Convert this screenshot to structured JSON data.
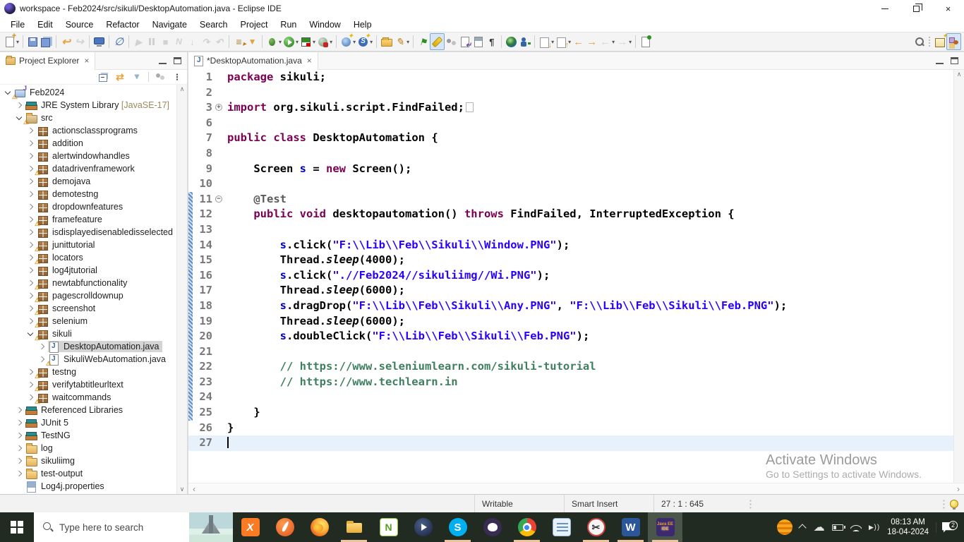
{
  "window": {
    "title": "workspace - Feb2024/src/sikuli/DesktopAutomation.java - Eclipse IDE",
    "controls": {
      "minimize": "minimize",
      "restore": "restore",
      "close": "×"
    }
  },
  "menu": {
    "items": [
      "File",
      "Edit",
      "Source",
      "Refactor",
      "Navigate",
      "Search",
      "Project",
      "Run",
      "Window",
      "Help"
    ]
  },
  "toolbar": {
    "items": [
      {
        "name": "new-wizard",
        "kind": "doc-new",
        "dd": true
      },
      {
        "sep": true
      },
      {
        "name": "save",
        "kind": "floppy"
      },
      {
        "name": "save-all",
        "kind": "floppy-all"
      },
      {
        "sep": true
      },
      {
        "name": "undo",
        "kind": "arr-undo"
      },
      {
        "name": "redo",
        "kind": "arr-redo",
        "dis": true
      },
      {
        "sep": true
      },
      {
        "name": "open-console",
        "kind": "monitor"
      },
      {
        "sep": true
      },
      {
        "name": "skip-all-breakpoints",
        "kind": "skipbp"
      },
      {
        "sep": true
      },
      {
        "name": "resume",
        "kind": "gplay",
        "dis": true
      },
      {
        "name": "suspend",
        "kind": "gpause",
        "dis": true
      },
      {
        "name": "terminate",
        "kind": "gstop",
        "dis": true
      },
      {
        "name": "disconnect",
        "kind": "gdisc",
        "dis": true
      },
      {
        "name": "step-into",
        "kind": "gstep1",
        "dis": true
      },
      {
        "name": "step-over",
        "kind": "gstep2",
        "dis": true
      },
      {
        "name": "step-return",
        "kind": "gstep3",
        "dis": true
      },
      {
        "sep": true
      },
      {
        "name": "run-last-tool",
        "kind": "linesrun"
      },
      {
        "name": "run-tool-config",
        "kind": "funnelrun"
      },
      {
        "sep": true
      },
      {
        "name": "debug",
        "kind": "bug",
        "dd": true
      },
      {
        "name": "run",
        "kind": "run",
        "dd": true
      },
      {
        "name": "coverage",
        "kind": "coverage",
        "dd": true
      },
      {
        "name": "profile",
        "kind": "profile",
        "dd": true
      },
      {
        "sep": true
      },
      {
        "name": "new-servlet",
        "kind": "globenew",
        "dd": true
      },
      {
        "name": "new-web-service",
        "kind": "sglobe",
        "dd": true
      },
      {
        "sep": true
      },
      {
        "name": "open-file",
        "kind": "folderopen"
      },
      {
        "name": "open-task",
        "kind": "pen",
        "dd": true
      },
      {
        "sep": true
      },
      {
        "name": "pin-editor",
        "kind": "pin"
      },
      {
        "name": "mark-occurrences",
        "kind": "highlighter",
        "active": true
      },
      {
        "name": "show-selected-element",
        "kind": "graydots"
      },
      {
        "name": "next-edit-location",
        "kind": "docarrow"
      },
      {
        "name": "last-edit-location",
        "kind": "doclines"
      },
      {
        "name": "show-whitespace",
        "kind": "pilcrow"
      },
      {
        "sep": true
      },
      {
        "name": "open-web-browser",
        "kind": "globe"
      },
      {
        "name": "run-external-tools",
        "kind": "personrun"
      },
      {
        "sep": true
      },
      {
        "name": "next-annotation",
        "kind": "boxdown",
        "dd": true
      },
      {
        "name": "previous-annotation",
        "kind": "boxup",
        "dd": true
      },
      {
        "name": "back-edit",
        "kind": "yleft"
      },
      {
        "name": "forward-edit",
        "kind": "yright"
      },
      {
        "name": "back",
        "kind": "gleft",
        "dd": true,
        "dis": true
      },
      {
        "name": "forward",
        "kind": "gright",
        "dd": true,
        "dis": true
      },
      {
        "sep": true
      },
      {
        "name": "new-untitled-file",
        "kind": "docpin"
      }
    ],
    "right": [
      {
        "name": "search",
        "kind": "mag"
      },
      {
        "dots": true
      },
      {
        "name": "open-perspective",
        "kind": "persp"
      },
      {
        "name": "perspective-javaee",
        "kind": "perspee",
        "active": true
      }
    ]
  },
  "explorer": {
    "tab_label": "Project Explorer",
    "close_label": "×",
    "toolbar": [
      {
        "name": "collapse-all",
        "kind": "collapse"
      },
      {
        "name": "link-with-editor",
        "kind": "link"
      },
      {
        "name": "filters",
        "kind": "filter"
      },
      {
        "sep": true
      },
      {
        "name": "focus-on-active-task",
        "kind": "focus"
      },
      {
        "name": "view-menu",
        "kind": "menu"
      }
    ],
    "tree": [
      {
        "label": "Feb2024",
        "depth": 0,
        "icon": "project",
        "arrow": "exp",
        "warn": true
      },
      {
        "label": "JRE System Library",
        "suffix": " [JavaSE-17]",
        "depth": 1,
        "icon": "lib",
        "arrow": "col"
      },
      {
        "label": "src",
        "depth": 1,
        "icon": "srcfolder",
        "arrow": "exp",
        "warn": true
      },
      {
        "label": "actionsclassprograms",
        "depth": 2,
        "icon": "pkg",
        "arrow": "col"
      },
      {
        "label": "addition",
        "depth": 2,
        "icon": "pkg",
        "arrow": "col"
      },
      {
        "label": "alertwindowhandles",
        "depth": 2,
        "icon": "pkg",
        "arrow": "col"
      },
      {
        "label": "datadrivenframework",
        "depth": 2,
        "icon": "pkg",
        "arrow": "col",
        "warn": true
      },
      {
        "label": "demojava",
        "depth": 2,
        "icon": "pkg",
        "arrow": "col"
      },
      {
        "label": "demotestng",
        "depth": 2,
        "icon": "pkg",
        "arrow": "col"
      },
      {
        "label": "dropdownfeatures",
        "depth": 2,
        "icon": "pkg",
        "arrow": "col"
      },
      {
        "label": "framefeature",
        "depth": 2,
        "icon": "pkg",
        "arrow": "col",
        "warn": true
      },
      {
        "label": "isdisplayedisenabledisselected",
        "depth": 2,
        "icon": "pkg",
        "arrow": "col"
      },
      {
        "label": "junittutorial",
        "depth": 2,
        "icon": "pkg",
        "arrow": "col",
        "warn": true
      },
      {
        "label": "locators",
        "depth": 2,
        "icon": "pkg",
        "arrow": "col",
        "warn": true
      },
      {
        "label": "log4jtutorial",
        "depth": 2,
        "icon": "pkg",
        "arrow": "col"
      },
      {
        "label": "newtabfunctionality",
        "depth": 2,
        "icon": "pkg",
        "arrow": "col",
        "warn": true
      },
      {
        "label": "pagescrolldownup",
        "depth": 2,
        "icon": "pkg",
        "arrow": "col",
        "warn": true
      },
      {
        "label": "screenshot",
        "depth": 2,
        "icon": "pkg",
        "arrow": "col",
        "warn": true
      },
      {
        "label": "selenium",
        "depth": 2,
        "icon": "pkg",
        "arrow": "col",
        "warn": true
      },
      {
        "label": "sikuli",
        "depth": 2,
        "icon": "pkg",
        "arrow": "exp",
        "warn": true
      },
      {
        "label": "DesktopAutomation.java",
        "depth": 3,
        "icon": "jfile",
        "arrow": "col",
        "selected": true
      },
      {
        "label": "SikuliWebAutomation.java",
        "depth": 3,
        "icon": "jfile",
        "arrow": "col",
        "warn": true
      },
      {
        "label": "testng",
        "depth": 2,
        "icon": "pkg",
        "arrow": "col",
        "warn": true
      },
      {
        "label": "verifytabtitleurltext",
        "depth": 2,
        "icon": "pkg",
        "arrow": "col",
        "warn": true
      },
      {
        "label": "waitcommands",
        "depth": 2,
        "icon": "pkg",
        "arrow": "col",
        "warn": true
      },
      {
        "label": "Referenced Libraries",
        "depth": 1,
        "icon": "lib",
        "arrow": "col"
      },
      {
        "label": "JUnit 5",
        "depth": 1,
        "icon": "lib",
        "arrow": "col"
      },
      {
        "label": "TestNG",
        "depth": 1,
        "icon": "lib",
        "arrow": "col"
      },
      {
        "label": "log",
        "depth": 1,
        "icon": "folder",
        "arrow": "col"
      },
      {
        "label": "sikuliimg",
        "depth": 1,
        "icon": "folder",
        "arrow": "col"
      },
      {
        "label": "test-output",
        "depth": 1,
        "icon": "folder",
        "arrow": "col"
      },
      {
        "label": "Log4j.properties",
        "depth": 1,
        "icon": "file",
        "arrow": "none"
      },
      {
        "label": "",
        "depth": 1,
        "icon": "folder",
        "arrow": "none"
      }
    ]
  },
  "editor": {
    "tab_label": "*DesktopAutomation.java",
    "close_label": "×",
    "lines": [
      {
        "n": "1",
        "seg": [
          [
            "kw",
            "package"
          ],
          [
            "def",
            " sikuli;"
          ]
        ]
      },
      {
        "n": "2",
        "seg": []
      },
      {
        "n": "3",
        "fold": "+",
        "seg": [
          [
            "kw",
            "import"
          ],
          [
            "def",
            " org.sikuli.script.FindFailed;"
          ],
          [
            "box",
            ""
          ]
        ]
      },
      {
        "n": "6",
        "seg": []
      },
      {
        "n": "7",
        "seg": [
          [
            "kw",
            "public"
          ],
          [
            "def",
            " "
          ],
          [
            "kw",
            "class"
          ],
          [
            "def",
            " DesktopAutomation {"
          ]
        ]
      },
      {
        "n": "8",
        "seg": []
      },
      {
        "n": "9",
        "seg": [
          [
            "def",
            "    Screen "
          ],
          [
            "fld",
            "s"
          ],
          [
            "def",
            " = "
          ],
          [
            "kw",
            "new"
          ],
          [
            "def",
            " Screen();"
          ]
        ]
      },
      {
        "n": "10",
        "seg": []
      },
      {
        "n": "11",
        "fold": "-",
        "diff": true,
        "seg": [
          [
            "ann",
            "    @Test"
          ]
        ]
      },
      {
        "n": "12",
        "diff": true,
        "seg": [
          [
            "def",
            "    "
          ],
          [
            "kw",
            "public"
          ],
          [
            "def",
            " "
          ],
          [
            "kw",
            "void"
          ],
          [
            "def",
            " desktopautomation() "
          ],
          [
            "kw",
            "throws"
          ],
          [
            "def",
            " FindFailed, InterruptedException {"
          ]
        ]
      },
      {
        "n": "13",
        "diff": true,
        "seg": []
      },
      {
        "n": "14",
        "diff": true,
        "seg": [
          [
            "def",
            "        "
          ],
          [
            "fld",
            "s"
          ],
          [
            "def",
            ".click("
          ],
          [
            "str",
            "\"F:\\\\Lib\\\\Feb\\\\Sikuli\\\\Window.PNG\""
          ],
          [
            "def",
            ");"
          ]
        ]
      },
      {
        "n": "15",
        "diff": true,
        "seg": [
          [
            "def",
            "        Thread."
          ],
          [
            "ital",
            "sleep"
          ],
          [
            "def",
            "(4000);"
          ]
        ]
      },
      {
        "n": "16",
        "diff": true,
        "seg": [
          [
            "def",
            "        "
          ],
          [
            "fld",
            "s"
          ],
          [
            "def",
            ".click("
          ],
          [
            "str",
            "\".//Feb2024//sikuliimg//Wi.PNG\""
          ],
          [
            "def",
            ");"
          ]
        ]
      },
      {
        "n": "17",
        "diff": true,
        "seg": [
          [
            "def",
            "        Thread."
          ],
          [
            "ital",
            "sleep"
          ],
          [
            "def",
            "(6000);"
          ]
        ]
      },
      {
        "n": "18",
        "diff": true,
        "seg": [
          [
            "def",
            "        "
          ],
          [
            "fld",
            "s"
          ],
          [
            "def",
            ".dragDrop("
          ],
          [
            "str",
            "\"F:\\\\Lib\\\\Feb\\\\Sikuli\\\\Any.PNG\""
          ],
          [
            "def",
            ", "
          ],
          [
            "str",
            "\"F:\\\\Lib\\\\Feb\\\\Sikuli\\\\Feb.PNG\""
          ],
          [
            "def",
            ");"
          ]
        ]
      },
      {
        "n": "19",
        "diff": true,
        "seg": [
          [
            "def",
            "        Thread."
          ],
          [
            "ital",
            "sleep"
          ],
          [
            "def",
            "(6000);"
          ]
        ]
      },
      {
        "n": "20",
        "diff": true,
        "seg": [
          [
            "def",
            "        "
          ],
          [
            "fld",
            "s"
          ],
          [
            "def",
            ".doubleClick("
          ],
          [
            "str",
            "\"F:\\\\Lib\\\\Feb\\\\Sikuli\\\\Feb.PNG\""
          ],
          [
            "def",
            ");"
          ]
        ]
      },
      {
        "n": "21",
        "diff": true,
        "seg": []
      },
      {
        "n": "22",
        "diff": true,
        "seg": [
          [
            "com",
            "        // https://www.seleniumlearn.com/sikuli-tutorial"
          ]
        ]
      },
      {
        "n": "23",
        "diff": true,
        "seg": [
          [
            "com",
            "        // https://www.techlearn.in"
          ]
        ]
      },
      {
        "n": "24",
        "diff": true,
        "seg": []
      },
      {
        "n": "25",
        "diff": true,
        "seg": [
          [
            "def",
            "    }"
          ]
        ]
      },
      {
        "n": "26",
        "seg": [
          [
            "def",
            "}"
          ]
        ]
      },
      {
        "n": "27",
        "current": true,
        "seg": [
          [
            "caret",
            ""
          ]
        ]
      }
    ],
    "watermark": {
      "line1": "Activate Windows",
      "line2": "Go to Settings to activate Windows."
    },
    "scroll": {
      "left_arrow": "‹",
      "right_arrow": "›",
      "up_arrow": "∧",
      "down_arrow": "∨"
    }
  },
  "statusbar": {
    "writable": "Writable",
    "insert_mode": "Smart Insert",
    "position": "27 : 1 : 645"
  },
  "taskbar": {
    "search_placeholder": "Type here to search",
    "apps": [
      {
        "name": "xampp",
        "cls": "ai-xampp",
        "glyph": "X"
      },
      {
        "name": "apache",
        "cls": "ai-apache",
        "glyph": ""
      },
      {
        "name": "firefox",
        "cls": "ai-firefox",
        "glyph": ""
      },
      {
        "name": "file-explorer",
        "cls": "ai-explorer",
        "glyph": "",
        "open": true
      },
      {
        "name": "notepad-plus-plus",
        "cls": "ai-npp",
        "glyph": ""
      },
      {
        "name": "media-player",
        "cls": "ai-media",
        "glyph": ""
      },
      {
        "name": "skype",
        "cls": "ai-skype",
        "glyph": "S",
        "open": true
      },
      {
        "name": "github",
        "cls": "ai-github",
        "glyph": ""
      },
      {
        "name": "chrome",
        "cls": "ai-chrome",
        "glyph": "",
        "open": true
      },
      {
        "name": "notepad",
        "cls": "ai-notepad",
        "glyph": ""
      },
      {
        "name": "snipping-tool",
        "cls": "ai-snip",
        "glyph": "",
        "open": true
      },
      {
        "name": "word",
        "cls": "ai-word",
        "glyph": "",
        "open": true
      },
      {
        "name": "eclipse",
        "cls": "ai-eclipse",
        "glyph": "",
        "open": true,
        "active": true
      }
    ],
    "tray": {
      "time": "08:13 AM",
      "date": "18-04-2024",
      "badge": "2"
    }
  },
  "colors": {
    "keyword": "#7b0052",
    "string": "#2a00ff",
    "comment": "#3f7f5f",
    "field": "#0000c0",
    "current_line": "#e7f1fb",
    "selection": "#d4d4d4",
    "taskbar": "#222b22",
    "taskbar_active": "#4b564b",
    "underline_indicator": "#ecc49a",
    "warning": "#e8a000"
  }
}
